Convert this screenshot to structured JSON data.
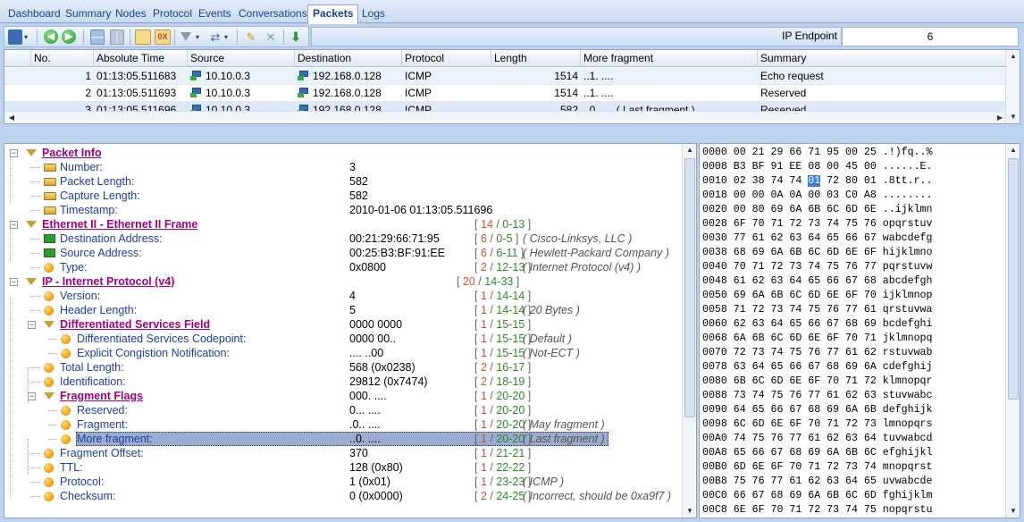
{
  "tabs": [
    {
      "label": "Dashboard",
      "active": false
    },
    {
      "label": "Summary",
      "active": false
    },
    {
      "label": "Nodes",
      "active": false
    },
    {
      "label": "Protocol",
      "active": false
    },
    {
      "label": "Events",
      "active": false
    },
    {
      "label": "Conversations",
      "active": false
    },
    {
      "label": "Packets",
      "active": true
    },
    {
      "label": "Logs",
      "active": false
    }
  ],
  "endpoint": {
    "label": "IP Endpoint",
    "value": "6"
  },
  "packet_grid": {
    "columns": [
      "No.",
      "Absolute Time",
      "Source",
      "Destination",
      "Protocol",
      "Length",
      "More fragment",
      "Summary"
    ],
    "rows": [
      {
        "no": "1",
        "time": "01:13:05.511683",
        "source": "10.10.0.3",
        "destination": "192.168.0.128",
        "protocol": "ICMP",
        "length": "1514",
        "more_fragment": "..1. ....",
        "summary": "Echo request"
      },
      {
        "no": "2",
        "time": "01:13:05.511693",
        "source": "10.10.0.3",
        "destination": "192.168.0.128",
        "protocol": "ICMP",
        "length": "1514",
        "more_fragment": "..1. ....",
        "summary": "Reserved"
      },
      {
        "no": "3",
        "time": "01:13:05.511696",
        "source": "10.10.0.3",
        "destination": "192.168.0.128",
        "protocol": "ICMP",
        "length": "582",
        "more_fragment": "..0. ....  ( Last fragment )",
        "summary": "Reserved"
      }
    ]
  },
  "details": [
    {
      "name": "Packet Info",
      "section": true,
      "level": 0,
      "icon": "funnel",
      "value": "",
      "range": "",
      "desc": ""
    },
    {
      "name": "Number:",
      "level": 1,
      "icon": "tag",
      "value": "3"
    },
    {
      "name": "Packet Length:",
      "level": 1,
      "icon": "tag",
      "value": "582"
    },
    {
      "name": "Capture Length:",
      "level": 1,
      "icon": "tag",
      "value": "582"
    },
    {
      "name": "Timestamp:",
      "level": 1,
      "icon": "tag",
      "value": "2010-01-06 01:13:05.511696"
    },
    {
      "name": "Ethernet II - Ethernet II Frame",
      "section": true,
      "level": 0,
      "icon": "funnel",
      "value": "",
      "ra": "14",
      "rb": "0-13"
    },
    {
      "name": "Destination Address:",
      "level": 1,
      "icon": "chip",
      "value": "00:21:29:66:71:95",
      "ra": "6",
      "rb": "0-5",
      "desc": "Cisco-Linksys, LLC"
    },
    {
      "name": "Source Address:",
      "level": 1,
      "icon": "chip",
      "value": "00:25:B3:BF:91:EE",
      "ra": "6",
      "rb": "6-11",
      "desc": "Hewlett-Packard Company"
    },
    {
      "name": "Type:",
      "level": 1,
      "icon": "orb",
      "value": "0x0800",
      "ra": "2",
      "rb": "12-13",
      "desc": "Internet Protocol (v4)"
    },
    {
      "name": "IP - Internet Protocol (v4)",
      "section": true,
      "level": 0,
      "icon": "funnel",
      "value": "",
      "ra": "20",
      "rb": "14-33"
    },
    {
      "name": "Version:",
      "level": 1,
      "icon": "orb",
      "value": "4",
      "ra": "1",
      "rb": "14-14"
    },
    {
      "name": "Header Length:",
      "level": 1,
      "icon": "orb",
      "value": "5",
      "ra": "1",
      "rb": "14-14",
      "desc": "20 Bytes"
    },
    {
      "name": "Differentiated Services Field",
      "section": true,
      "level": 1,
      "icon": "funnel",
      "value": "0000 0000",
      "ra": "1",
      "rb": "15-15"
    },
    {
      "name": "Differentiated Services Codepoint:",
      "level": 2,
      "icon": "orb",
      "value": "0000 00..",
      "ra": "1",
      "rb": "15-15",
      "desc": "Default"
    },
    {
      "name": "Explicit Congistion Notification:",
      "level": 2,
      "icon": "orb",
      "value": ".... ..00",
      "ra": "1",
      "rb": "15-15",
      "desc": "Not-ECT"
    },
    {
      "name": "Total Length:",
      "level": 1,
      "icon": "orb",
      "value": "568 (0x0238)",
      "ra": "2",
      "rb": "16-17"
    },
    {
      "name": "Identification:",
      "level": 1,
      "icon": "orb",
      "value": "29812 (0x7474)",
      "ra": "2",
      "rb": "18-19"
    },
    {
      "name": "Fragment Flags",
      "section": true,
      "level": 1,
      "icon": "funnel",
      "value": "000. ....",
      "ra": "1",
      "rb": "20-20"
    },
    {
      "name": "Reserved:",
      "level": 2,
      "icon": "orb",
      "value": "0... ....",
      "ra": "1",
      "rb": "20-20"
    },
    {
      "name": "Fragment:",
      "level": 2,
      "icon": "orb",
      "value": ".0.. ....",
      "ra": "1",
      "rb": "20-20",
      "desc": "May fragment"
    },
    {
      "name": "More fragment:",
      "level": 2,
      "icon": "orb",
      "value": "..0. ....",
      "ra": "1",
      "rb": "20-20",
      "desc": "Last fragment",
      "selected": true
    },
    {
      "name": "Fragment Offset:",
      "level": 1,
      "icon": "orb",
      "value": "370",
      "ra": "1",
      "rb": "21-21"
    },
    {
      "name": "TTL:",
      "level": 1,
      "icon": "orb",
      "value": "128 (0x80)",
      "ra": "1",
      "rb": "22-22"
    },
    {
      "name": "Protocol:",
      "level": 1,
      "icon": "orb",
      "value": "1 (0x01)",
      "ra": "1",
      "rb": "23-23",
      "desc": "ICMP"
    },
    {
      "name": "Checksum:",
      "level": 1,
      "icon": "orb",
      "value": "0 (0x0000)",
      "ra": "2",
      "rb": "24-25",
      "desc": "Incorrect, should be 0xa9f7"
    }
  ],
  "hex_rows": [
    {
      "offset": "0000",
      "bytes": "00 21 29 66 71 95 00 25",
      "ascii": ".!)fq..%"
    },
    {
      "offset": "0008",
      "bytes": "B3 BF 91 EE 08 00 45 00",
      "ascii": "......E."
    },
    {
      "offset": "0010",
      "bytes_pre": "02 38 74 74 ",
      "bytes_sel": "01",
      "bytes_post": " 72 80 01",
      "ascii": ".8tt.r.."
    },
    {
      "offset": "0018",
      "bytes": "00 00 0A 0A 00 03 C0 A8",
      "ascii": "........"
    },
    {
      "offset": "0020",
      "bytes": "00 80 69 6A 6B 6C 6D 6E",
      "ascii": "..ijklmn"
    },
    {
      "offset": "0028",
      "bytes": "6F 70 71 72 73 74 75 76",
      "ascii": "opqrstuv"
    },
    {
      "offset": "0030",
      "bytes": "77 61 62 63 64 65 66 67",
      "ascii": "wabcdefg"
    },
    {
      "offset": "0038",
      "bytes": "68 69 6A 6B 6C 6D 6E 6F",
      "ascii": "hijklmno"
    },
    {
      "offset": "0040",
      "bytes": "70 71 72 73 74 75 76 77",
      "ascii": "pqrstuvw"
    },
    {
      "offset": "0048",
      "bytes": "61 62 63 64 65 66 67 68",
      "ascii": "abcdefgh"
    },
    {
      "offset": "0050",
      "bytes": "69 6A 6B 6C 6D 6E 6F 70",
      "ascii": "ijklmnop"
    },
    {
      "offset": "0058",
      "bytes": "71 72 73 74 75 76 77 61",
      "ascii": "qrstuvwa"
    },
    {
      "offset": "0060",
      "bytes": "62 63 64 65 66 67 68 69",
      "ascii": "bcdefghi"
    },
    {
      "offset": "0068",
      "bytes": "6A 6B 6C 6D 6E 6F 70 71",
      "ascii": "jklmnopq"
    },
    {
      "offset": "0070",
      "bytes": "72 73 74 75 76 77 61 62",
      "ascii": "rstuvwab"
    },
    {
      "offset": "0078",
      "bytes": "63 64 65 66 67 68 69 6A",
      "ascii": "cdefghij"
    },
    {
      "offset": "0080",
      "bytes": "6B 6C 6D 6E 6F 70 71 72",
      "ascii": "klmnopqr"
    },
    {
      "offset": "0088",
      "bytes": "73 74 75 76 77 61 62 63",
      "ascii": "stuvwabc"
    },
    {
      "offset": "0090",
      "bytes": "64 65 66 67 68 69 6A 6B",
      "ascii": "defghijk"
    },
    {
      "offset": "0098",
      "bytes": "6C 6D 6E 6F 70 71 72 73",
      "ascii": "lmnopqrs"
    },
    {
      "offset": "00A0",
      "bytes": "74 75 76 77 61 62 63 64",
      "ascii": "tuvwabcd"
    },
    {
      "offset": "00A8",
      "bytes": "65 66 67 68 69 6A 6B 6C",
      "ascii": "efghijkl"
    },
    {
      "offset": "00B0",
      "bytes": "6D 6E 6F 70 71 72 73 74",
      "ascii": "mnopqrst"
    },
    {
      "offset": "00B8",
      "bytes": "75 76 77 61 62 63 64 65",
      "ascii": "uvwabcde"
    },
    {
      "offset": "00C0",
      "bytes": "66 67 68 69 6A 6B 6C 6D",
      "ascii": "fghijklm"
    },
    {
      "offset": "00C8",
      "bytes": "6E 6F 70 71 72 73 74 75",
      "ascii": "nopqrstu"
    }
  ],
  "colors": {
    "section": "#a3007c",
    "field": "#1a3fa8",
    "range_a": "#d0502a",
    "range_b": "#2a8a2a",
    "hex_selection": "#3a7bd5"
  },
  "toolbar_icons": [
    "save-dropdown-icon",
    "back-icon",
    "forward-icon",
    "layout-horizontal-icon",
    "layout-vertical-icon",
    "tree-view-icon",
    "hex-view-icon",
    "filter-icon",
    "filter-dropdown-icon",
    "refresh-options-icon",
    "edit-icon",
    "clear-icon",
    "export-icon"
  ]
}
